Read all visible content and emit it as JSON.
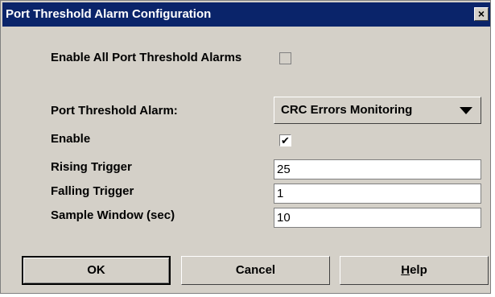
{
  "window": {
    "title": "Port Threshold Alarm Configuration",
    "close_label": "×"
  },
  "enable_all": {
    "label": "Enable All Port Threshold Alarms",
    "checked": false
  },
  "alarm_selector": {
    "label": "Port Threshold Alarm:",
    "selected": "CRC Errors Monitoring"
  },
  "enable": {
    "label": "Enable",
    "checked": true,
    "check_glyph": "✔"
  },
  "rising_trigger": {
    "label": "Rising Trigger",
    "value": "25"
  },
  "falling_trigger": {
    "label": "Falling Trigger",
    "value": "1"
  },
  "sample_window": {
    "label": "Sample Window (sec)",
    "value": "10"
  },
  "buttons": {
    "ok": "OK",
    "cancel": "Cancel",
    "help": "Help"
  },
  "colors": {
    "title_bar": "#0a246a",
    "dialog_bg": "#d4d0c8"
  }
}
